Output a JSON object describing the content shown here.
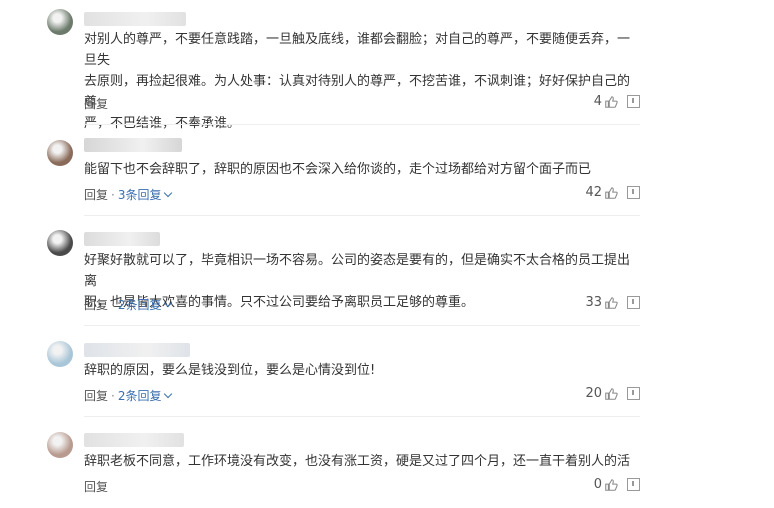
{
  "comments": [
    {
      "text_lines": [
        "对别人的尊严，不要任意践踏，一旦触及底线，谁都会翻脸；对自己的尊严，不要随便丢弃，一旦失",
        "去原则，再捡起很难。为人处事：认真对待别人的尊严，不挖苦谁，不讽刺谁；好好保护自己的尊",
        "严，不巴结谁，不奉承谁。"
      ],
      "reply_label": "回复",
      "replies_label": "",
      "likes": "4",
      "avatar_color": "#6b7a6a",
      "name_color": "#dcdcdc"
    },
    {
      "text_lines": [
        "能留下也不会辞职了，辞职的原因也不会深入给你谈的，走个过场都给对方留个面子而已"
      ],
      "reply_label": "回复",
      "replies_label": "3条回复",
      "likes": "42",
      "avatar_color": "#8a6b5a",
      "name_color": "#cfcfcf"
    },
    {
      "text_lines": [
        "好聚好散就可以了，毕竟相识一场不容易。公司的姿态是要有的，但是确实不太合格的员工提出离",
        "职，也是皆大欢喜的事情。只不过公司要给予离职员工足够的尊重。"
      ],
      "reply_label": "回复",
      "replies_label": "2条回复",
      "likes": "33",
      "avatar_color": "#4a4a4a",
      "name_color": "#d6d6d6"
    },
    {
      "text_lines": [
        "辞职的原因，要么是钱没到位，要么是心情没到位!"
      ],
      "reply_label": "回复",
      "replies_label": "2条回复",
      "likes": "20",
      "avatar_color": "#a9c6d8",
      "name_color": "#d9dee4"
    },
    {
      "text_lines": [
        "辞职老板不同意，工作环境没有改变，也没有涨工资，硬是又过了四个月，还一直干着别人的活"
      ],
      "reply_label": "回复",
      "replies_label": "",
      "likes": "0",
      "avatar_color": "#b89a8e",
      "name_color": "#dcdcdc"
    }
  ],
  "colors": {
    "accent": "#3a6fb0",
    "divider": "#eeeeee"
  }
}
